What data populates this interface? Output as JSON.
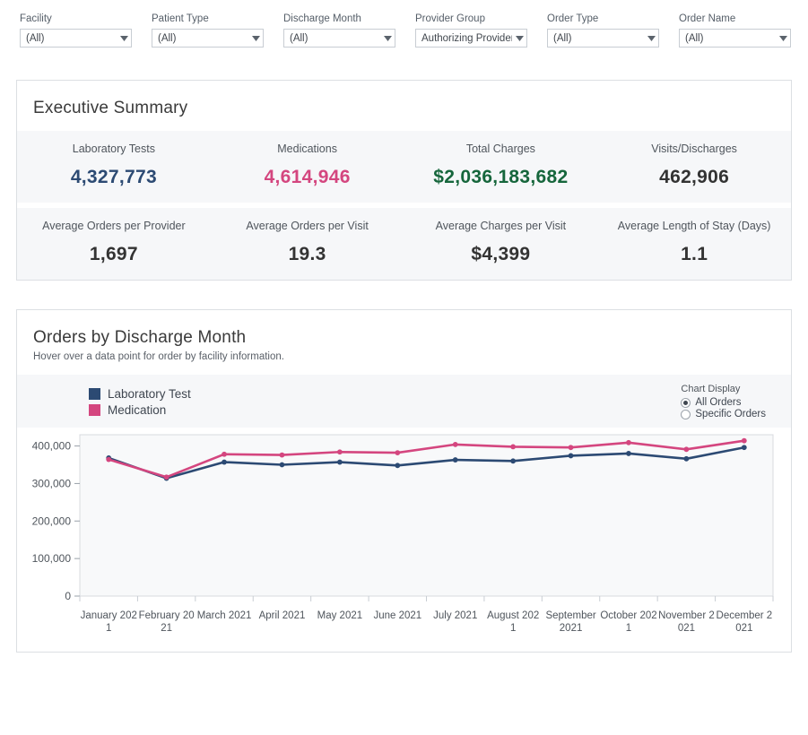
{
  "filters": [
    {
      "label": "Facility",
      "value": "(All)",
      "name": "facility"
    },
    {
      "label": "Patient Type",
      "value": "(All)",
      "name": "patient-type"
    },
    {
      "label": "Discharge Month",
      "value": "(All)",
      "name": "discharge-month"
    },
    {
      "label": "Provider Group",
      "value": "Authorizing Provider",
      "name": "provider-group"
    },
    {
      "label": "Order Type",
      "value": "(All)",
      "name": "order-type"
    },
    {
      "label": "Order Name",
      "value": "(All)",
      "name": "order-name"
    }
  ],
  "executive_summary": {
    "title": "Executive Summary",
    "row1": [
      {
        "label": "Laboratory Tests",
        "value": "4,327,773",
        "color": "#2c4a73"
      },
      {
        "label": "Medications",
        "value": "4,614,946",
        "color": "#d4467f"
      },
      {
        "label": "Total Charges",
        "value": "$2,036,183,682",
        "color": "#16663c"
      },
      {
        "label": "Visits/Discharges",
        "value": "462,906",
        "color": "#333333"
      }
    ],
    "row2": [
      {
        "label": "Average Orders per Provider",
        "value": "1,697",
        "color": "#333333"
      },
      {
        "label": "Average Orders per Visit",
        "value": "19.3",
        "color": "#333333"
      },
      {
        "label": "Average Charges per Visit",
        "value": "$4,399",
        "color": "#333333"
      },
      {
        "label": "Average Length of Stay (Days)",
        "value": "1.1",
        "color": "#333333"
      }
    ]
  },
  "chart_section": {
    "title": "Orders by Discharge Month",
    "subtitle": "Hover over a data point for order by facility information.",
    "chart_display": {
      "title": "Chart Display",
      "options": [
        {
          "label": "All Orders",
          "selected": true
        },
        {
          "label": "Specific Orders",
          "selected": false
        }
      ]
    }
  },
  "chart_data": {
    "type": "line",
    "title": "Orders by Discharge Month",
    "xlabel": "",
    "ylabel": "",
    "ylim": [
      0,
      430000
    ],
    "yticks": [
      0,
      100000,
      200000,
      300000,
      400000
    ],
    "ytick_labels": [
      "0",
      "100,000",
      "200,000",
      "300,000",
      "400,000"
    ],
    "grid": false,
    "legend_position": "top-left",
    "categories": [
      "January 2021",
      "February 2021",
      "March 2021",
      "April 2021",
      "May 2021",
      "June 2021",
      "July 2021",
      "August 2021",
      "September 2021",
      "October 2021",
      "November 2021",
      "December 2021"
    ],
    "series": [
      {
        "name": "Laboratory Test",
        "color": "#2c4a73",
        "values": [
          368000,
          314000,
          357000,
          350000,
          357000,
          348000,
          363000,
          360000,
          374000,
          380000,
          366000,
          396000
        ]
      },
      {
        "name": "Medication",
        "color": "#d4467f",
        "values": [
          364000,
          317000,
          378000,
          376000,
          384000,
          382000,
          404000,
          398000,
          396000,
          409000,
          391000,
          414000
        ]
      }
    ]
  }
}
